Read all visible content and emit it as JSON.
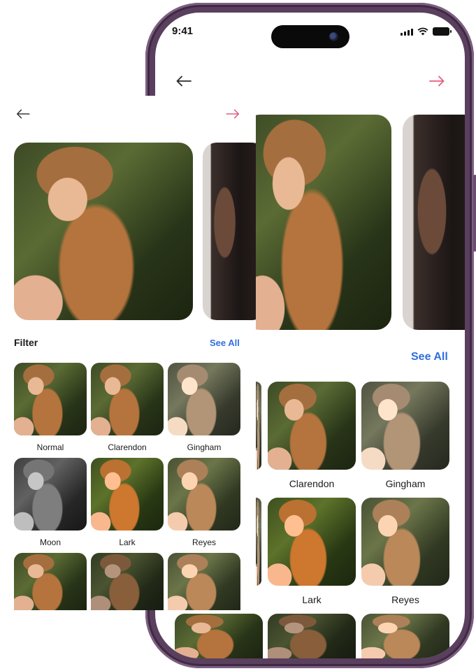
{
  "status_bar": {
    "time": "9:41"
  },
  "colors": {
    "accent": "#2f6fe0",
    "forward_arrow": "#e0607e",
    "frame": "#5a3f5e"
  },
  "icons": {
    "back": "arrow-left-icon",
    "forward": "arrow-right-icon"
  },
  "filter_section": {
    "title": "Filter",
    "see_all_label": "See All"
  },
  "filters_front": [
    {
      "name": "Normal"
    },
    {
      "name": "Clarendon"
    },
    {
      "name": "Gingham"
    },
    {
      "name": "Moon"
    },
    {
      "name": "Lark"
    },
    {
      "name": "Reyes"
    }
  ],
  "filters_phone": [
    {
      "name": "Clarendon"
    },
    {
      "name": "Gingham"
    },
    {
      "name": "Lark"
    },
    {
      "name": "Reyes"
    }
  ]
}
